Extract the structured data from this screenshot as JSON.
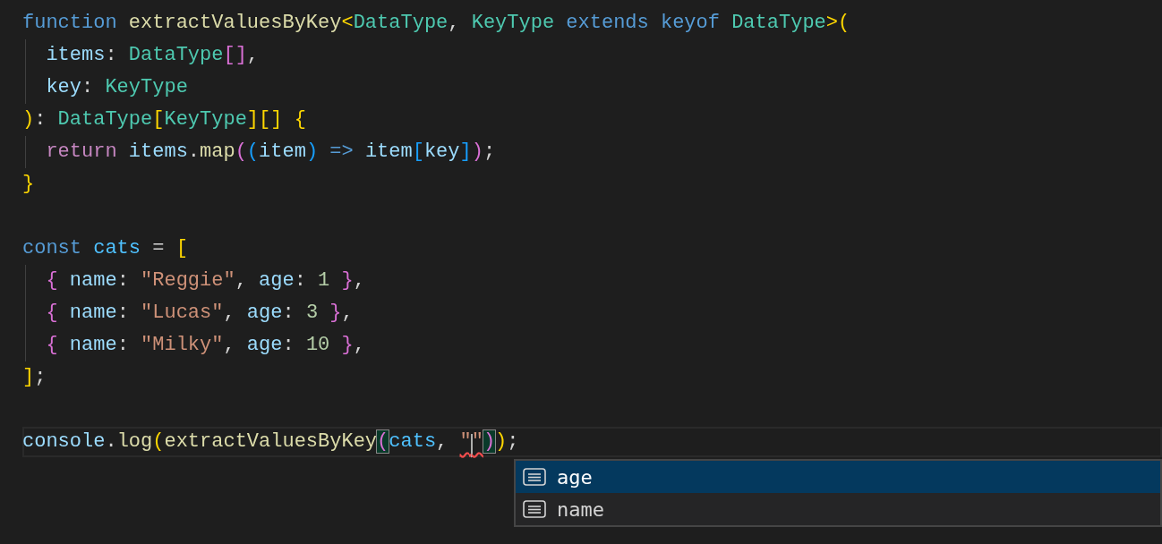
{
  "code_lines": [
    {
      "current": false,
      "tokens": [
        {
          "text": "function ",
          "kind": "keyword"
        },
        {
          "text": "extractValuesByKey",
          "kind": "function"
        },
        {
          "text": "<",
          "kind": "bracket1"
        },
        {
          "text": "DataType",
          "kind": "type"
        },
        {
          "text": ", ",
          "kind": "punct"
        },
        {
          "text": "KeyType ",
          "kind": "type"
        },
        {
          "text": "extends ",
          "kind": "keyword"
        },
        {
          "text": "keyof ",
          "kind": "keyword"
        },
        {
          "text": "DataType",
          "kind": "type"
        },
        {
          "text": ">(",
          "kind": "bracket1"
        }
      ]
    },
    {
      "current": false,
      "tokens": [
        {
          "text": "  items",
          "kind": "variable"
        },
        {
          "text": ": ",
          "kind": "punct"
        },
        {
          "text": "DataType",
          "kind": "type"
        },
        {
          "text": "[]",
          "kind": "bracket2"
        },
        {
          "text": ",",
          "kind": "punct"
        }
      ]
    },
    {
      "current": false,
      "tokens": [
        {
          "text": "  key",
          "kind": "variable"
        },
        {
          "text": ": ",
          "kind": "punct"
        },
        {
          "text": "KeyType",
          "kind": "type"
        }
      ]
    },
    {
      "current": false,
      "tokens": [
        {
          "text": ")",
          "kind": "bracket1"
        },
        {
          "text": ": ",
          "kind": "punct"
        },
        {
          "text": "DataType",
          "kind": "type"
        },
        {
          "text": "[",
          "kind": "bracket1"
        },
        {
          "text": "KeyType",
          "kind": "type"
        },
        {
          "text": "][] {",
          "kind": "bracket1"
        }
      ]
    },
    {
      "current": false,
      "tokens": [
        {
          "text": "  return ",
          "kind": "control"
        },
        {
          "text": "items",
          "kind": "variable"
        },
        {
          "text": ".",
          "kind": "punct"
        },
        {
          "text": "map",
          "kind": "function"
        },
        {
          "text": "(",
          "kind": "bracket2"
        },
        {
          "text": "(",
          "kind": "bracket3"
        },
        {
          "text": "item",
          "kind": "variable"
        },
        {
          "text": ") ",
          "kind": "bracket3"
        },
        {
          "text": "=> ",
          "kind": "keyword"
        },
        {
          "text": "item",
          "kind": "variable"
        },
        {
          "text": "[",
          "kind": "bracket3"
        },
        {
          "text": "key",
          "kind": "variable"
        },
        {
          "text": "]",
          "kind": "bracket3"
        },
        {
          "text": ")",
          "kind": "bracket2"
        },
        {
          "text": ";",
          "kind": "punct"
        }
      ]
    },
    {
      "current": false,
      "tokens": [
        {
          "text": "}",
          "kind": "bracket1"
        }
      ]
    },
    {
      "current": false
    },
    {
      "current": false,
      "tokens": [
        {
          "text": "const ",
          "kind": "keyword"
        },
        {
          "text": "cats",
          "kind": "constant"
        },
        {
          "text": " = ",
          "kind": "punct"
        },
        {
          "text": "[",
          "kind": "bracket1"
        }
      ]
    },
    {
      "current": false,
      "tokens": [
        {
          "text": "  { ",
          "kind": "bracket2"
        },
        {
          "text": "name",
          "kind": "variable"
        },
        {
          "text": ": ",
          "kind": "punct"
        },
        {
          "text": "\"Reggie\"",
          "kind": "string"
        },
        {
          "text": ", ",
          "kind": "punct"
        },
        {
          "text": "age",
          "kind": "variable"
        },
        {
          "text": ": ",
          "kind": "punct"
        },
        {
          "text": "1 ",
          "kind": "number"
        },
        {
          "text": "}",
          "kind": "bracket2"
        },
        {
          "text": ",",
          "kind": "punct"
        }
      ]
    },
    {
      "current": false,
      "tokens": [
        {
          "text": "  { ",
          "kind": "bracket2"
        },
        {
          "text": "name",
          "kind": "variable"
        },
        {
          "text": ": ",
          "kind": "punct"
        },
        {
          "text": "\"Lucas\"",
          "kind": "string"
        },
        {
          "text": ", ",
          "kind": "punct"
        },
        {
          "text": "age",
          "kind": "variable"
        },
        {
          "text": ": ",
          "kind": "punct"
        },
        {
          "text": "3 ",
          "kind": "number"
        },
        {
          "text": "}",
          "kind": "bracket2"
        },
        {
          "text": ",",
          "kind": "punct"
        }
      ]
    },
    {
      "current": false,
      "tokens": [
        {
          "text": "  { ",
          "kind": "bracket2"
        },
        {
          "text": "name",
          "kind": "variable"
        },
        {
          "text": ": ",
          "kind": "punct"
        },
        {
          "text": "\"Milky\"",
          "kind": "string"
        },
        {
          "text": ", ",
          "kind": "punct"
        },
        {
          "text": "age",
          "kind": "variable"
        },
        {
          "text": ": ",
          "kind": "punct"
        },
        {
          "text": "10 ",
          "kind": "number"
        },
        {
          "text": "}",
          "kind": "bracket2"
        },
        {
          "text": ",",
          "kind": "punct"
        }
      ]
    },
    {
      "current": false,
      "tokens": [
        {
          "text": "]",
          "kind": "bracket1"
        },
        {
          "text": ";",
          "kind": "punct"
        }
      ]
    },
    {
      "current": false
    },
    {
      "current": true,
      "tokens": [
        {
          "text": "console",
          "kind": "variable"
        },
        {
          "text": ".",
          "kind": "punct"
        },
        {
          "text": "log",
          "kind": "function"
        },
        {
          "text": "(",
          "kind": "bracket1"
        },
        {
          "text": "extractValuesByKey",
          "kind": "function"
        },
        {
          "text": "(",
          "kind": "bracket2",
          "matched": true
        },
        {
          "text": "cats",
          "kind": "constant"
        },
        {
          "text": ", ",
          "kind": "punct"
        },
        {
          "text": "\"",
          "kind": "string",
          "error": true,
          "cursor_after": true
        },
        {
          "text": "\"",
          "kind": "string",
          "error": true
        },
        {
          "text": ")",
          "kind": "bracket2",
          "matched": true
        },
        {
          "text": ")",
          "kind": "bracket1"
        },
        {
          "text": ";",
          "kind": "punct"
        }
      ]
    }
  ],
  "suggestions": [
    {
      "label": "age",
      "selected": true
    },
    {
      "label": "name",
      "selected": false
    }
  ]
}
